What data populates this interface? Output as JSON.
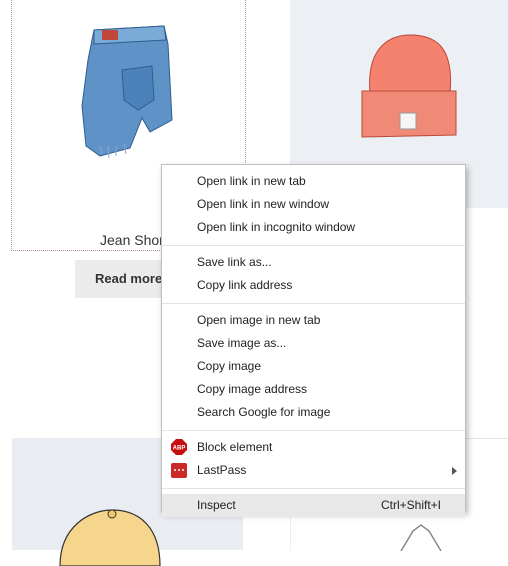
{
  "products": [
    {
      "title": "Jean Short",
      "button_label": "Read more",
      "image_icon": "jean-shorts-illustration"
    },
    {
      "image_icon": "beanie-illustration"
    },
    {
      "image_icon": "cap-illustration"
    },
    {
      "image_icon": "hoodie-illustration"
    }
  ],
  "context_menu": {
    "groups": [
      [
        "Open link in new tab",
        "Open link in new window",
        "Open link in incognito window"
      ],
      [
        "Save link as...",
        "Copy link address"
      ],
      [
        "Open image in new tab",
        "Save image as...",
        "Copy image",
        "Copy image address",
        "Search Google for image"
      ],
      [
        "Block element",
        "LastPass"
      ],
      [
        "Inspect"
      ]
    ],
    "inspect_shortcut": "Ctrl+Shift+I",
    "abp_icon_text": "ABP",
    "icons": {
      "block_element": "adblock-plus-icon",
      "lastpass": "lastpass-icon"
    },
    "colors": {
      "abp": "#c70d0d",
      "lastpass": "#cc2929",
      "hover": "#e8e8e8"
    }
  }
}
